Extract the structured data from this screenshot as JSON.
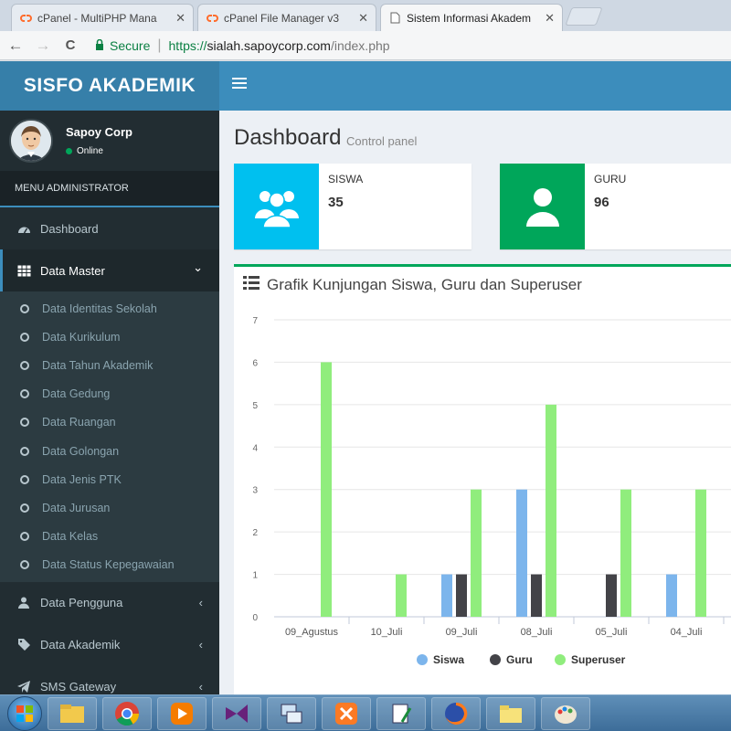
{
  "browser": {
    "tabs": [
      {
        "label": "cPanel - MultiPHP Mana",
        "icon": "cpanel-icon",
        "active": false
      },
      {
        "label": "cPanel File Manager v3",
        "icon": "cpanel-icon",
        "active": false
      },
      {
        "label": "Sistem Informasi Akadem",
        "icon": "page-icon",
        "active": true
      }
    ],
    "close_glyph": "✕",
    "back_glyph": "←",
    "forward_glyph": "→",
    "reload_glyph": "C",
    "secure_label": "Secure",
    "url_scheme": "https://",
    "url_host": "sialah.sapoycorp.com",
    "url_path": "/index.php"
  },
  "sidebar": {
    "brand": "SISFO AKADEMIK",
    "user_name": "Sapoy Corp",
    "user_status": "Online",
    "menu_header": "MENU ADMINISTRATOR",
    "items_top": [
      {
        "label": "Dashboard",
        "icon": "dashboard-icon"
      },
      {
        "label": "Data Master",
        "icon": "table-icon",
        "chevron": "⌄"
      }
    ],
    "submenu": [
      "Data Identitas Sekolah",
      "Data Kurikulum",
      "Data Tahun Akademik",
      "Data Gedung",
      "Data Ruangan",
      "Data Golongan",
      "Data Jenis PTK",
      "Data Jurusan",
      "Data Kelas",
      "Data Status Kepegawaian"
    ],
    "items_bottom": [
      {
        "label": "Data Pengguna",
        "icon": "user-icon",
        "chevron": "‹"
      },
      {
        "label": "Data Akademik",
        "icon": "tag-icon",
        "chevron": "‹"
      },
      {
        "label": "SMS Gateway",
        "icon": "send-icon",
        "chevron": "‹"
      }
    ]
  },
  "main": {
    "title": "Dashboard",
    "subtitle": "Control panel",
    "info_boxes": [
      {
        "label": "SISWA",
        "value": "35",
        "color": "#00c0ef",
        "icon": "users-icon"
      },
      {
        "label": "GURU",
        "value": "96",
        "color": "#00a65a",
        "icon": "user-icon"
      }
    ]
  },
  "chart_data": {
    "type": "bar",
    "title": "Grafik Kunjungan Siswa, Guru dan Superuser",
    "categories": [
      "09_Agustus",
      "10_Juli",
      "09_Juli",
      "08_Juli",
      "05_Juli",
      "04_Juli"
    ],
    "series": [
      {
        "name": "Siswa",
        "color": "#7cb5ec",
        "values": [
          0,
          0,
          1,
          3,
          0,
          1
        ]
      },
      {
        "name": "Guru",
        "color": "#434348",
        "values": [
          0,
          0,
          1,
          1,
          1,
          0
        ]
      },
      {
        "name": "Superuser",
        "color": "#90ed7d",
        "values": [
          6,
          1,
          3,
          5,
          3,
          3
        ]
      }
    ],
    "ylim": [
      0,
      7
    ],
    "yticks": [
      0,
      1,
      2,
      3,
      4,
      5,
      6,
      7
    ],
    "grid": true,
    "legend": "bottom"
  },
  "taskbar": {
    "apps": [
      "explorer-icon",
      "chrome-icon",
      "media-player-icon",
      "visual-studio-icon",
      "network-icon",
      "xampp-icon",
      "notepad-icon",
      "firefox-icon",
      "folder-icon",
      "paint-icon"
    ]
  }
}
